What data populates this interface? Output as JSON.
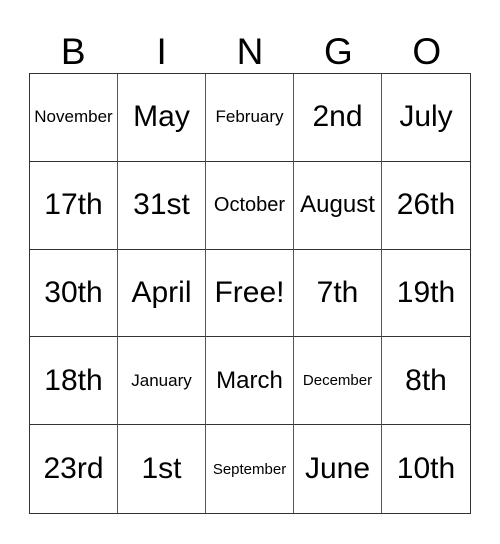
{
  "header": [
    "B",
    "I",
    "N",
    "G",
    "O"
  ],
  "rows": [
    [
      "November",
      "May",
      "February",
      "2nd",
      "July"
    ],
    [
      "17th",
      "31st",
      "October",
      "August",
      "26th"
    ],
    [
      "30th",
      "April",
      "Free!",
      "7th",
      "19th"
    ],
    [
      "18th",
      "January",
      "March",
      "December",
      "8th"
    ],
    [
      "23rd",
      "1st",
      "September",
      "June",
      "10th"
    ]
  ]
}
